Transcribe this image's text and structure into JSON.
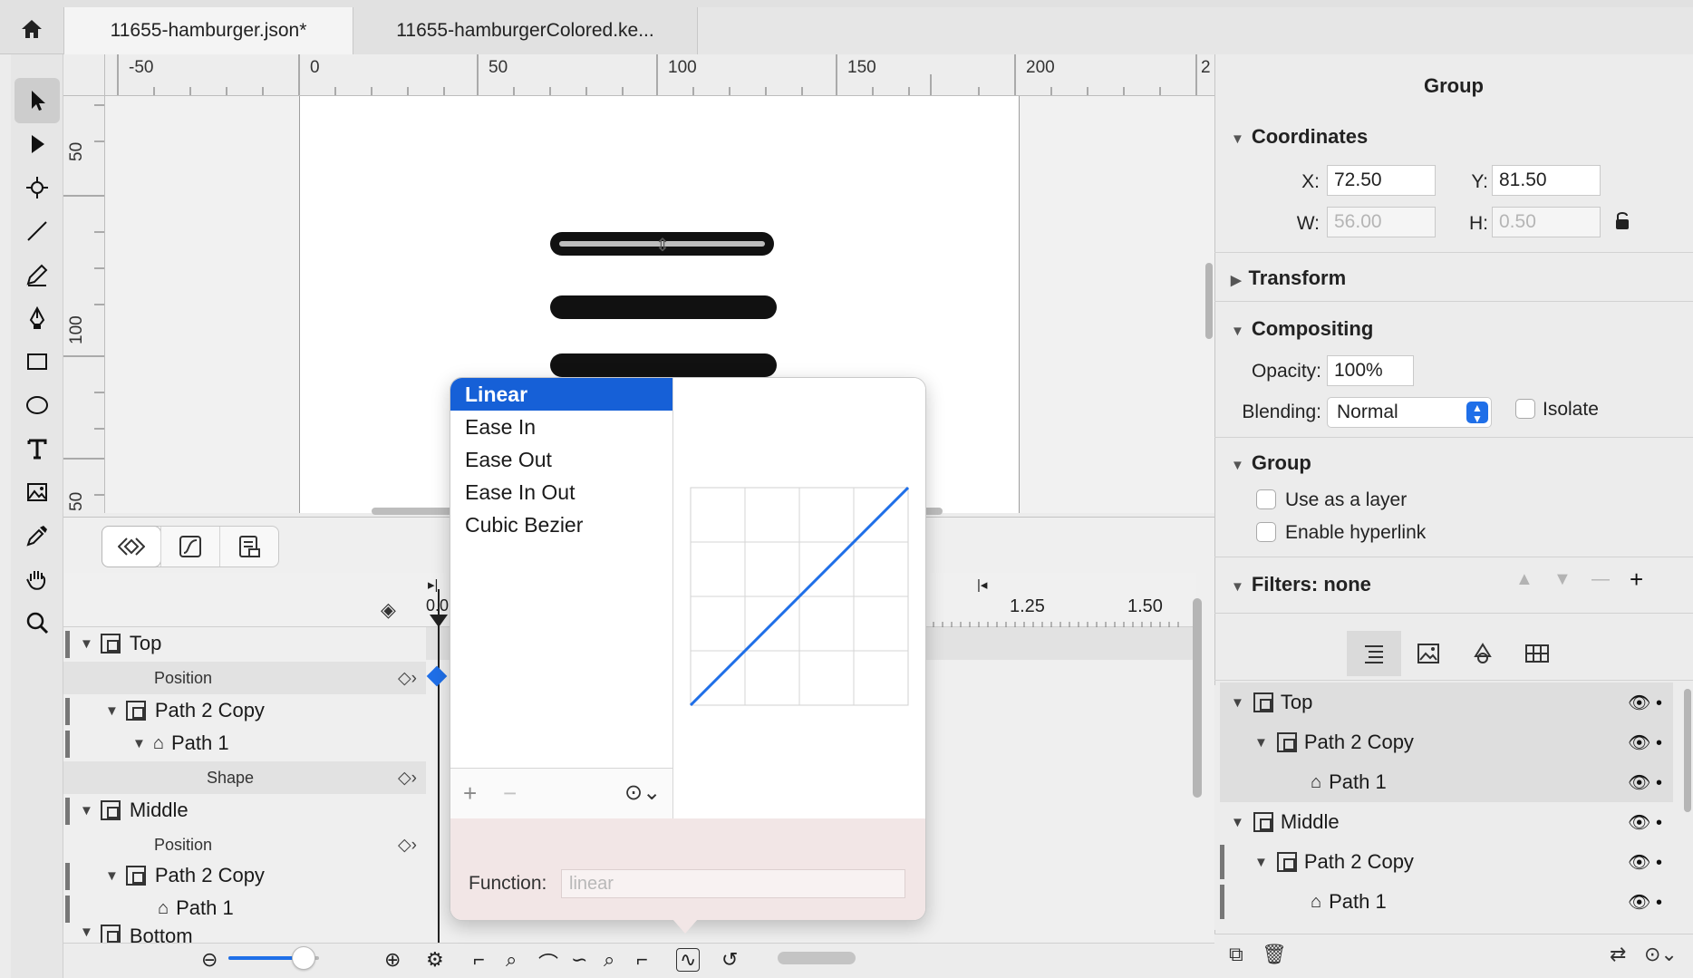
{
  "tabs": [
    {
      "label": "11655-hamburger.json*",
      "active": true
    },
    {
      "label": "11655-hamburgerColored.ke...",
      "active": false
    }
  ],
  "toolbar": {
    "tools": [
      "select-arrow-icon",
      "direct-select-icon",
      "anchor-icon",
      "line-icon",
      "pencil-icon",
      "pen-icon",
      "rectangle-icon",
      "ellipse-icon",
      "text-icon",
      "image-icon",
      "eyedropper-icon",
      "hand-icon",
      "zoom-icon"
    ]
  },
  "ruler": {
    "h_labels": [
      "-50",
      "0",
      "50",
      "100",
      "150",
      "200",
      "2"
    ],
    "v_labels": [
      "50",
      "100",
      "50"
    ]
  },
  "popover": {
    "easing_options": [
      "Linear",
      "Ease In",
      "Ease Out",
      "Ease In Out",
      "Cubic Bezier"
    ],
    "selected": "Linear",
    "add_label": "+",
    "remove_label": "−",
    "function_label": "Function:",
    "function_placeholder": "linear"
  },
  "timeline": {
    "ruler_labels": [
      "1.25",
      "1.50"
    ],
    "playhead_label": "0.0",
    "rows": [
      {
        "label": "Top"
      },
      {
        "label": "Position"
      },
      {
        "label": "Path 2 Copy"
      },
      {
        "label": "Path 1"
      },
      {
        "label": "Shape"
      },
      {
        "label": "Middle"
      },
      {
        "label": "Position"
      },
      {
        "label": "Path 2 Copy"
      },
      {
        "label": "Path 1"
      },
      {
        "label": "Bottom"
      }
    ]
  },
  "inspector": {
    "title": "Group",
    "coordinates": {
      "header": "Coordinates",
      "x_label": "X:",
      "x_value": "72.50",
      "y_label": "Y:",
      "y_value": "81.50",
      "w_label": "W:",
      "w_value": "56.00",
      "h_label": "H:",
      "h_value": "0.50"
    },
    "transform_header": "Transform",
    "compositing": {
      "header": "Compositing",
      "opacity_label": "Opacity:",
      "opacity_value": "100%",
      "blending_label": "Blending:",
      "blending_value": "Normal",
      "isolate_label": "Isolate"
    },
    "group": {
      "header": "Group",
      "use_as_layer": "Use as a layer",
      "enable_hyperlink": "Enable hyperlink"
    },
    "filters_header": "Filters: none",
    "layers": [
      {
        "label": "Top"
      },
      {
        "label": "Path 2 Copy"
      },
      {
        "label": "Path 1"
      },
      {
        "label": "Middle"
      },
      {
        "label": "Path 2 Copy"
      },
      {
        "label": "Path 1"
      }
    ]
  },
  "colors": {
    "accent": "#1f6fe8",
    "selection": "#1660d7",
    "popover_footer": "#f2e6e6"
  }
}
